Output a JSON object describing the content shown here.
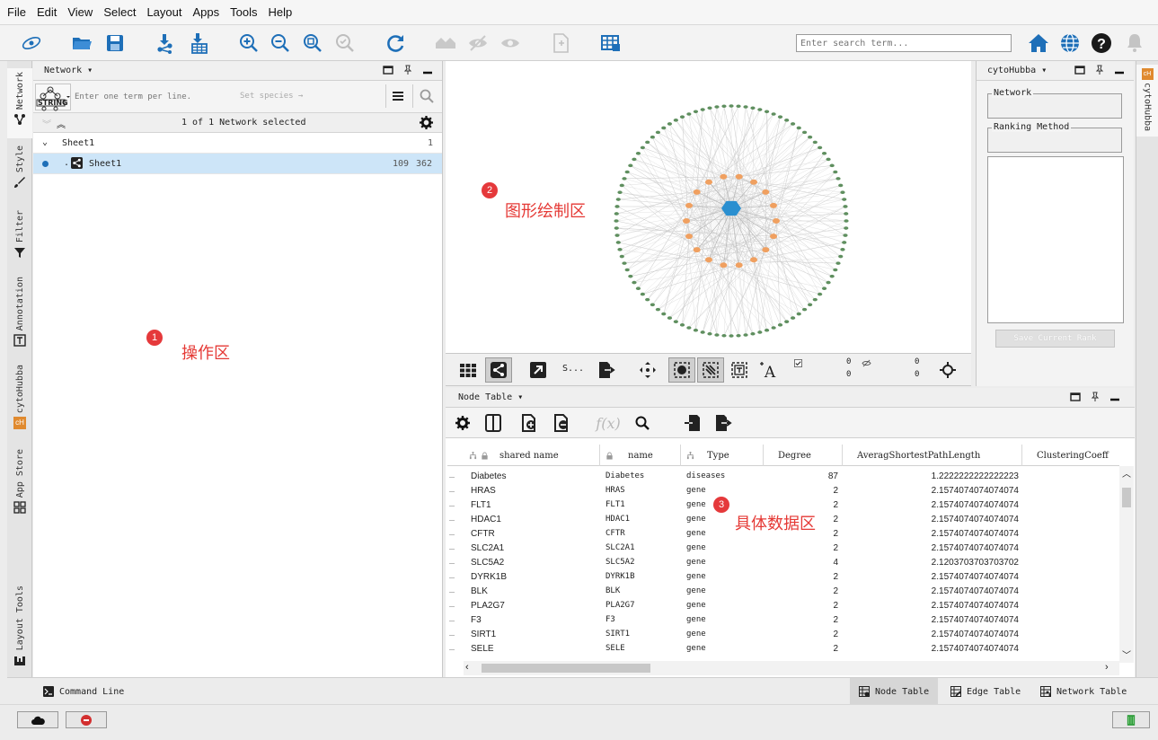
{
  "menu": [
    "File",
    "Edit",
    "View",
    "Select",
    "Layout",
    "Apps",
    "Tools",
    "Help"
  ],
  "search": {
    "placeholder": "Enter search term..."
  },
  "left_tabs": [
    "Network",
    "Style",
    "Filter",
    "Annotation",
    "cytoHubba",
    "App Store",
    "Layout Tools"
  ],
  "right_tabs": [
    "cytoHubba"
  ],
  "network_panel": {
    "title": "Network",
    "string_button": "STRING",
    "query_placeholder": "Enter one term per line.",
    "species_placeholder": "Set species →",
    "selection_status": "1 of 1 Network selected",
    "collection": {
      "name": "Sheet1",
      "count": "1"
    },
    "network": {
      "name": "Sheet1",
      "nodes": "109",
      "edges": "362",
      "prefix": "."
    }
  },
  "canvas_toolbar": {
    "style_label": "S...",
    "sel_nodes": "0",
    "sel_nodes2": "0",
    "hid_nodes": "0",
    "hid_nodes2": "0"
  },
  "hubba": {
    "title": "cytoHubba",
    "network_label": "Network",
    "ranking_label": "Ranking Method",
    "save_button": "Save Current Rank"
  },
  "node_table": {
    "title": "Node Table",
    "columns": [
      "shared name",
      "name",
      "Type",
      "Degree",
      "AveragShortestPathLength",
      "ClusteringCoeff"
    ],
    "rows": [
      [
        "Diabetes",
        "Diabetes",
        "diseases",
        "87",
        "1.2222222222222223"
      ],
      [
        "HRAS",
        "HRAS",
        "gene",
        "2",
        "2.1574074074074074"
      ],
      [
        "FLT1",
        "FLT1",
        "gene",
        "2",
        "2.1574074074074074"
      ],
      [
        "HDAC1",
        "HDAC1",
        "gene",
        "2",
        "2.1574074074074074"
      ],
      [
        "CFTR",
        "CFTR",
        "gene",
        "2",
        "2.1574074074074074"
      ],
      [
        "SLC2A1",
        "SLC2A1",
        "gene",
        "2",
        "2.1574074074074074"
      ],
      [
        "SLC5A2",
        "SLC5A2",
        "gene",
        "4",
        "2.1203703703703702"
      ],
      [
        "DYRK1B",
        "DYRK1B",
        "gene",
        "2",
        "2.1574074074074074"
      ],
      [
        "BLK",
        "BLK",
        "gene",
        "2",
        "2.1574074074074074"
      ],
      [
        "PLA2G7",
        "PLA2G7",
        "gene",
        "2",
        "2.1574074074074074"
      ],
      [
        "F3",
        "F3",
        "gene",
        "2",
        "2.1574074074074074"
      ],
      [
        "SIRT1",
        "SIRT1",
        "gene",
        "2",
        "2.1574074074074074"
      ],
      [
        "SELE",
        "SELE",
        "gene",
        "2",
        "2.1574074074074074"
      ]
    ]
  },
  "bottom_tabs": {
    "command_line": "Command Line",
    "node_table": "Node Table",
    "edge_table": "Edge Table",
    "network_table": "Network Table"
  },
  "annotations": [
    {
      "num": "1",
      "text": "操作区"
    },
    {
      "num": "2",
      "text": "图形绘制区"
    },
    {
      "num": "3",
      "text": "具体数据区"
    }
  ],
  "colors": {
    "accent_blue": "#1e6fb8",
    "node_green": "#5f8f5f",
    "node_orange": "#f0a060",
    "hub_blue": "#2a8fd0",
    "annotation_red": "#e53935"
  }
}
